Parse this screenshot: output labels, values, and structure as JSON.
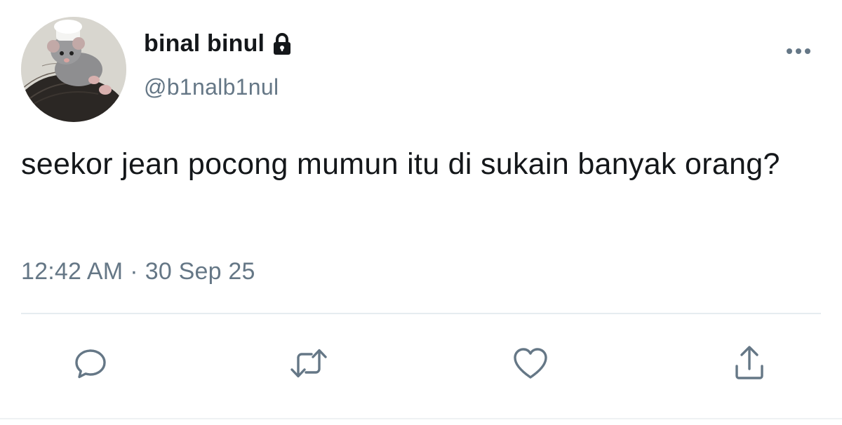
{
  "tweet": {
    "author": {
      "display_name": "binal binul",
      "handle": "@b1nalb1nul",
      "protected_icon": "lock-icon",
      "avatar_icon": "mouse-plush-avatar"
    },
    "text": "seekor jean pocong mumun itu di sukain banyak orang?",
    "time": "12:42 AM",
    "separator": "·",
    "date": "30 Sep 25"
  },
  "actions": {
    "items": [
      "reply-icon",
      "retweet-icon",
      "like-icon",
      "share-icon"
    ],
    "color": "#657786"
  },
  "menu": {
    "icon": "more-icon"
  },
  "colors": {
    "text": "#14171a",
    "secondary": "#657786",
    "divider": "#e6ecf0"
  }
}
